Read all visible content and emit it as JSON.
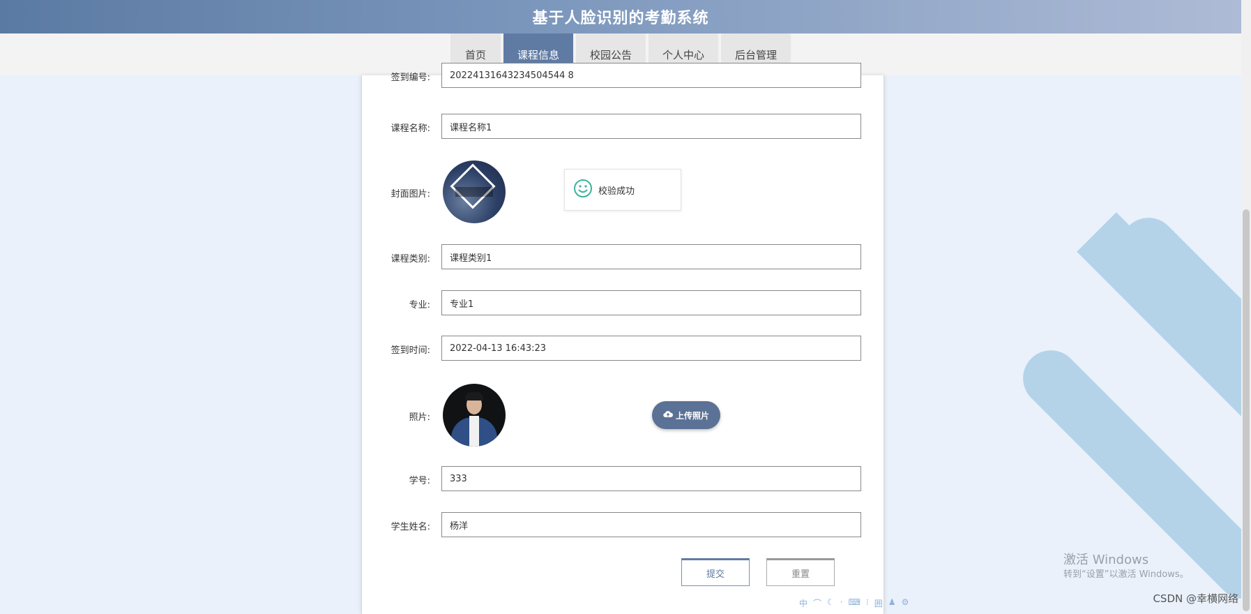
{
  "header": {
    "title": "基于人脸识别的考勤系统"
  },
  "nav": {
    "items": [
      {
        "label": "首页",
        "active": false
      },
      {
        "label": "课程信息",
        "active": true
      },
      {
        "label": "校园公告",
        "active": false
      },
      {
        "label": "个人中心",
        "active": false
      },
      {
        "label": "后台管理",
        "active": false
      }
    ]
  },
  "form": {
    "sign_no": {
      "label": "签到编号:",
      "value": "20224131643234504544 8"
    },
    "course_name": {
      "label": "课程名称:",
      "value": "课程名称1"
    },
    "cover": {
      "label": "封面图片:"
    },
    "course_type": {
      "label": "课程类别:",
      "value": "课程类别1"
    },
    "major": {
      "label": "专业:",
      "value": "专业1"
    },
    "sign_time": {
      "label": "签到时间:",
      "value": "2022-04-13 16:43:23"
    },
    "photo": {
      "label": "照片:",
      "upload_label": "上传照片"
    },
    "student_no": {
      "label": "学号:",
      "value": "333"
    },
    "student_name": {
      "label": "学生姓名:",
      "value": "杨洋"
    }
  },
  "toast": {
    "text": "校验成功",
    "icon": "smile-icon",
    "icon_color": "#3bb39a"
  },
  "buttons": {
    "submit": "提交",
    "reset": "重置"
  },
  "watermark": {
    "title": "激活 Windows",
    "subtitle": "转到“设置”以激活 Windows。"
  },
  "footer": {
    "csdn": "CSDN @幸横网络"
  },
  "ime": {
    "items": [
      "中",
      "⌒",
      "☾",
      "·",
      "⌨",
      "⁝",
      "囲",
      "♟",
      "⚙"
    ]
  },
  "colors": {
    "accent": "#5f7ba4",
    "background": "#eaf1fb",
    "stripe": "#b5d3e8"
  }
}
